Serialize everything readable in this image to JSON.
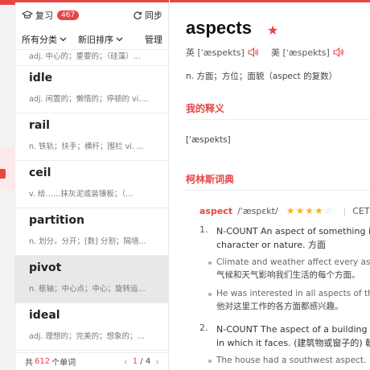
{
  "toolbar": {
    "review_label": "复习",
    "review_count": "467",
    "sync_label": "同步",
    "category_label": "所有分类",
    "sort_label": "新旧排序",
    "manage_label": "管理"
  },
  "word_list": {
    "items": [
      {
        "word": "",
        "def": "adj. 中心的；重要的；（硅藻）..."
      },
      {
        "word": "idle",
        "def": "adj. 闲置的；懒惰的；停顿的 vi...."
      },
      {
        "word": "rail",
        "def": "n. 铁轨；扶手；横杆；围栏 vi. ..."
      },
      {
        "word": "ceil",
        "def": "v. 给……抹灰泥或装镶板；（..."
      },
      {
        "word": "partition",
        "def": "n. 划分，分开；[数] 分割；隔墙..."
      },
      {
        "word": "pivot",
        "def": "n. 枢轴；中心点；中心；旋转运..."
      },
      {
        "word": "ideal",
        "def": "adj. 理想的；完美的；想象的；..."
      }
    ],
    "footer": {
      "prefix": "共",
      "total": "612",
      "suffix": "个单词",
      "prev": "‹",
      "page": "1",
      "slash": "/",
      "pages": "4",
      "next": "›"
    }
  },
  "detail": {
    "headword": "aspects",
    "star": "★",
    "uk_label": "英 [ˈæspekts]",
    "us_label": "美 [ˈæspekts]",
    "brief_def": "n. 方面；方位；面貌（aspect 的复数）",
    "my_def_title": "我的释义",
    "ipa": "[ˈæspekts]",
    "collins_title": "柯林斯词典",
    "collins": {
      "word": "aspect",
      "phonetic": "/ˈæspɛkt/",
      "stars_on": "★★★★",
      "stars_off": "☆",
      "sep": "|",
      "level": "CET"
    },
    "senses": [
      {
        "num": "1.",
        "line1": "N-COUNT An aspect of something is on",
        "line2": "character or nature. 方面",
        "examples": [
          {
            "en": "Climate and weather affect every aspe",
            "zh": "气候和天气影响我们生活的每个方面。"
          },
          {
            "en": "He was interested in all aspects of the",
            "zh": "他对这里工作的各方面都感兴趣。"
          }
        ]
      },
      {
        "num": "2.",
        "line1": "N-COUNT The aspect of a building or w",
        "line2": "in which it faces. (建筑物或窗子的) 朝向",
        "examples": [
          {
            "en": "The house had a southwest aspect.",
            "zh": ""
          }
        ]
      }
    ]
  }
}
